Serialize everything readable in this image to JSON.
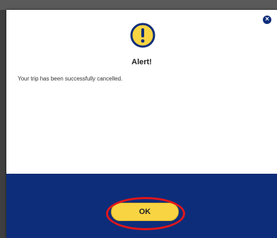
{
  "dialog": {
    "title": "Alert!",
    "message": "Your trip has been successfully cancelled.",
    "ok_label": "OK",
    "close_label": "×",
    "icon": "exclamation-circle-icon"
  },
  "colors": {
    "brand_navy": "#0d2d7a",
    "accent_yellow": "#f8d442",
    "highlight_red": "#e0161c"
  }
}
